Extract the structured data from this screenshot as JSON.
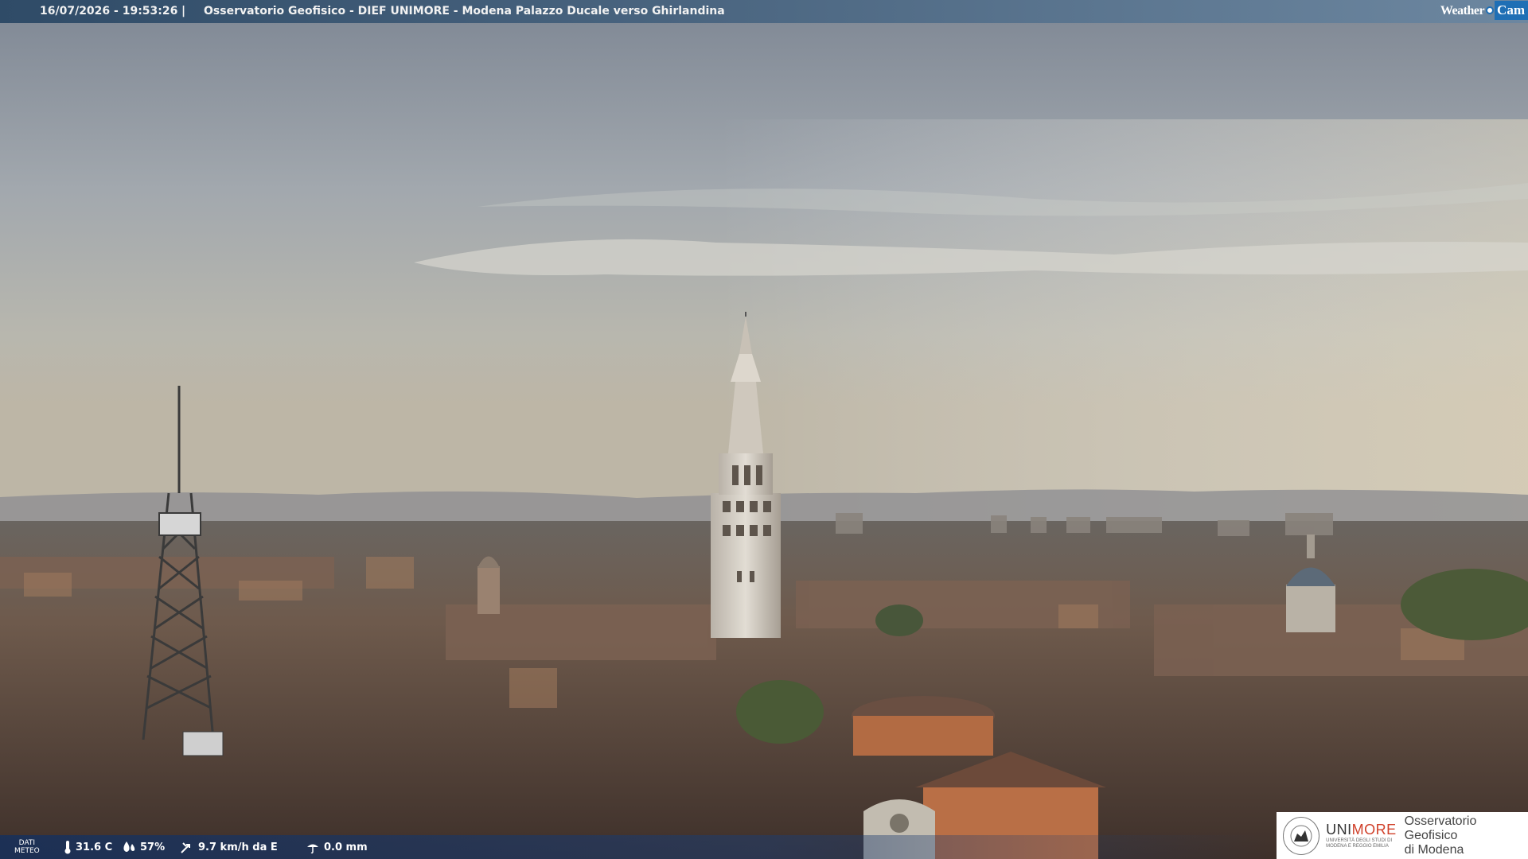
{
  "header": {
    "timestamp": "16/07/2026 - 19:53:26",
    "separator": "|",
    "title": "Osservatorio Geofisico - DIEF UNIMORE - Modena Palazzo Ducale verso Ghirlandina",
    "brand_weather": "Weather",
    "brand_cam": "Cam"
  },
  "weather": {
    "label_line1": "DATI",
    "label_line2": "METEO",
    "temperature": "31.6 C",
    "humidity": "57%",
    "wind": "9.7 km/h da E",
    "rain": "0.0 mm",
    "icons": [
      "thermometer-icon",
      "humidity-icon",
      "wind-icon",
      "rain-icon"
    ]
  },
  "logo": {
    "uni_prefix": "UNI",
    "uni_suffix": "MORE",
    "uni_subtitle_line1": "UNIVERSITÀ DEGLI STUDI DI",
    "uni_subtitle_line2": "MODENA E REGGIO EMILIA",
    "obs_line1": "Osservatorio Geofisico",
    "obs_line2": "di Modena"
  },
  "colors": {
    "sky_top": "#8c95a3",
    "sky_bottom": "#c9c4b3",
    "roofs": "#6b5548",
    "tower": "#d8d2c8",
    "accent_blue": "#1f6fb5",
    "unimore_red": "#d0402a"
  }
}
